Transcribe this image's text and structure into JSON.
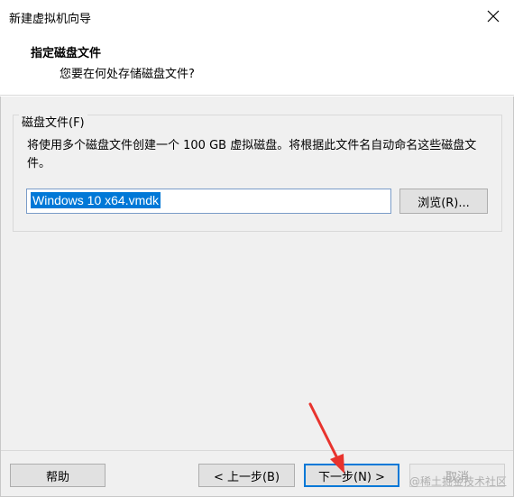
{
  "window": {
    "title": "新建虚拟机向导",
    "close_icon": "close-icon"
  },
  "header": {
    "title": "指定磁盘文件",
    "subtitle": "您要在何处存储磁盘文件?"
  },
  "disk_group": {
    "label": "磁盘文件(F)",
    "description": "将使用多个磁盘文件创建一个 100 GB 虚拟磁盘。将根据此文件名自动命名这些磁盘文件。",
    "filename_value": "Windows 10 x64.vmdk",
    "browse_label": "浏览(R)..."
  },
  "footer": {
    "help_label": "帮助",
    "back_label": "< 上一步(B)",
    "next_label": "下一步(N) >",
    "cancel_label": "取消"
  },
  "watermark": "@稀土掘金技术社区",
  "colors": {
    "accent": "#0078d7",
    "arrow": "#e8332d"
  }
}
